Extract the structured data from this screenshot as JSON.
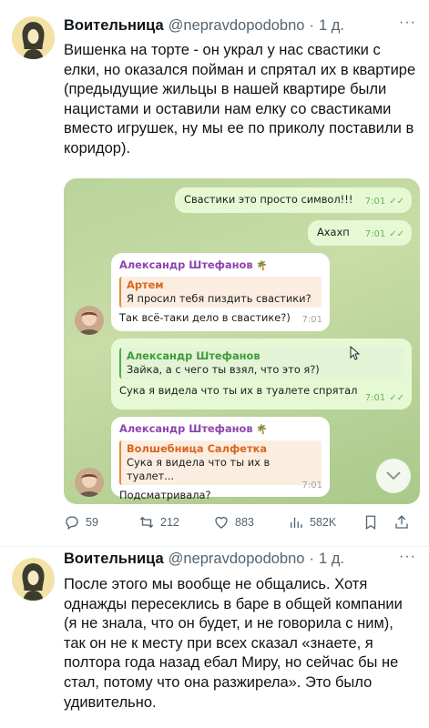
{
  "tweet1": {
    "name": "Воительница",
    "handle": "@nepravdopodobno",
    "dot": "·",
    "time": "1 д.",
    "more": "···",
    "text": "Вишенка на торте - он украл у нас свастики с елки, но оказался пойман и спрятал их в квартире (предыдущие жильцы в нашей квартире были нацистами и оставили нам елку со свастиками вместо игрушек, ну мы ее по приколу поставили в коридор).",
    "chat": {
      "m1": {
        "text": "Свастики это просто символ!!!",
        "time": "7:01",
        "checks": "✓✓"
      },
      "m2": {
        "text": "Ахахп",
        "time": "7:01",
        "checks": "✓✓"
      },
      "m3": {
        "sender": "Александр Штефанов",
        "palm": "🌴",
        "quote_name": "Артем",
        "quote_text": "Я просил тебя пиздить свастики?",
        "text": "Так всё-таки дело в свастике?)",
        "time": "7:01"
      },
      "m4": {
        "quote_name": "Александр Штефанов",
        "quote_text": "Зайка, а с чего ты взял, что это я?)",
        "text": "Сука я видела что ты их в туалете спрятал",
        "time": "7:01",
        "checks": "✓✓"
      },
      "m5": {
        "sender": "Александр Штефанов",
        "palm": "🌴",
        "quote_name": "Волшебница Салфетка",
        "quote_text": "Сука я видела что ты их в туалет...",
        "text": "Подсматривала?",
        "time": "7:01"
      },
      "scroll_icon": "chevron-down-icon"
    },
    "actions": {
      "replies": "59",
      "retweets": "212",
      "likes": "883",
      "views": "582K"
    }
  },
  "tweet2": {
    "name": "Воительница",
    "handle": "@nepravdopodobno",
    "dot": "·",
    "time": "1 д.",
    "more": "···",
    "text": "После этого мы вообще не общались. Хотя однажды пересеклись в баре в общей компании (я не знала, что он будет, и не говорила с ним), так он не к месту при всех сказал «знаете, я полтора года назад ебал Миру, но сейчас бы не стал, потому что она разжирела». Это было удивительно."
  },
  "colors": {
    "accent": "#1d9bf0",
    "muted": "#536471",
    "chat_out": "#e6f9d4",
    "chat_bg": "#c8dca6"
  }
}
